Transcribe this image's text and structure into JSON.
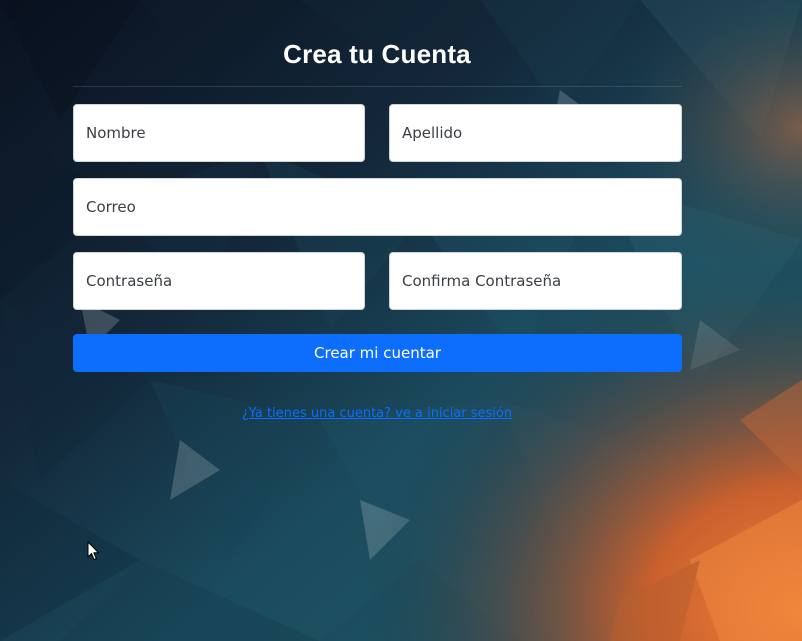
{
  "page": {
    "title": "Crea tu Cuenta"
  },
  "form": {
    "nombre_placeholder": "Nombre",
    "apellido_placeholder": "Apellido",
    "correo_placeholder": "Correo",
    "contrasena_placeholder": "Contraseña",
    "confirma_placeholder": "Confirma Contraseña",
    "submit_label": "Crear mi cuentar"
  },
  "footer": {
    "login_link_text": "¿Ya tienes una cuenta? ve a iniciar sesión"
  },
  "colors": {
    "primary": "#0d6efd",
    "title_text": "#ffffff",
    "background_dark": "#0d1a28",
    "background_accent": "#e07a3a"
  },
  "icons": {
    "cursor": "mouse-pointer-icon"
  }
}
